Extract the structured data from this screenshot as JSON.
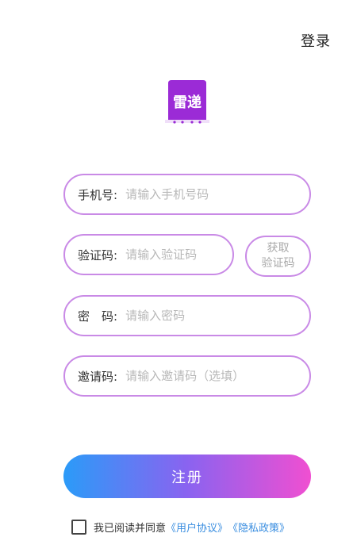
{
  "header": {
    "login_label": "登录"
  },
  "logo": {
    "icon": "app-logo-icon",
    "text": "雷递",
    "color": "#9b2bd6"
  },
  "form": {
    "phone": {
      "label": "手机号:",
      "placeholder": "请输入手机号码"
    },
    "code": {
      "label": "验证码:",
      "placeholder": "请输入验证码",
      "get_code_line1": "获取",
      "get_code_line2": "验证码"
    },
    "password": {
      "label": "密　码:",
      "placeholder": "请输入密码"
    },
    "invite": {
      "label": "邀请码:",
      "placeholder": "请输入邀请码（选填）"
    }
  },
  "register_label": "注册",
  "agreement": {
    "prefix": "我已阅读并同意",
    "user_agreement": "《用户协议》",
    "privacy_policy": "《隐私政策》"
  },
  "colors": {
    "border": "#c98ae6",
    "gradient_start": "#2b9bf8",
    "gradient_mid": "#8a63f0",
    "gradient_end": "#f04fd1",
    "link": "#3a8ee0"
  }
}
